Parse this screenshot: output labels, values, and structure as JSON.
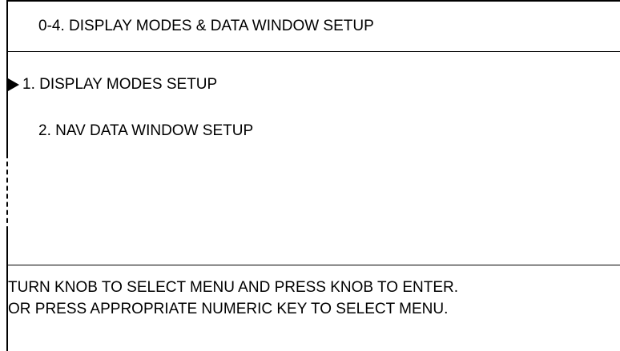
{
  "header": {
    "title": "0-4. DISPLAY MODES & DATA WINDOW SETUP"
  },
  "menu": {
    "items": [
      {
        "label": "1. DISPLAY MODES SETUP",
        "selected": true
      },
      {
        "label": "2. NAV DATA WINDOW SETUP",
        "selected": false
      }
    ],
    "cursor_icon": "triangle-right-icon"
  },
  "footer": {
    "line1": "TURN KNOB TO SELECT MENU AND PRESS KNOB TO ENTER.",
    "line2": "OR PRESS APPROPRIATE NUMERIC KEY TO SELECT MENU."
  }
}
